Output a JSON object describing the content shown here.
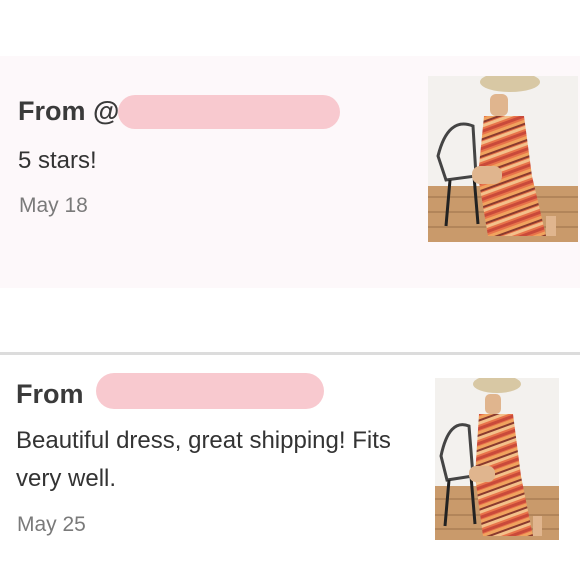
{
  "reviews": [
    {
      "from_label": "From @",
      "message": "5 stars!",
      "date": "May 18",
      "thumbnail_icon": "dress-photo"
    },
    {
      "from_label": "From",
      "message": "Beautiful dress, great shipping! Fits very well.",
      "date": "May 25",
      "thumbnail_icon": "dress-photo"
    }
  ],
  "colors": {
    "redaction": "#f8c9cf",
    "card_background": "#fdf8fa",
    "divider": "#dcdcdc"
  }
}
